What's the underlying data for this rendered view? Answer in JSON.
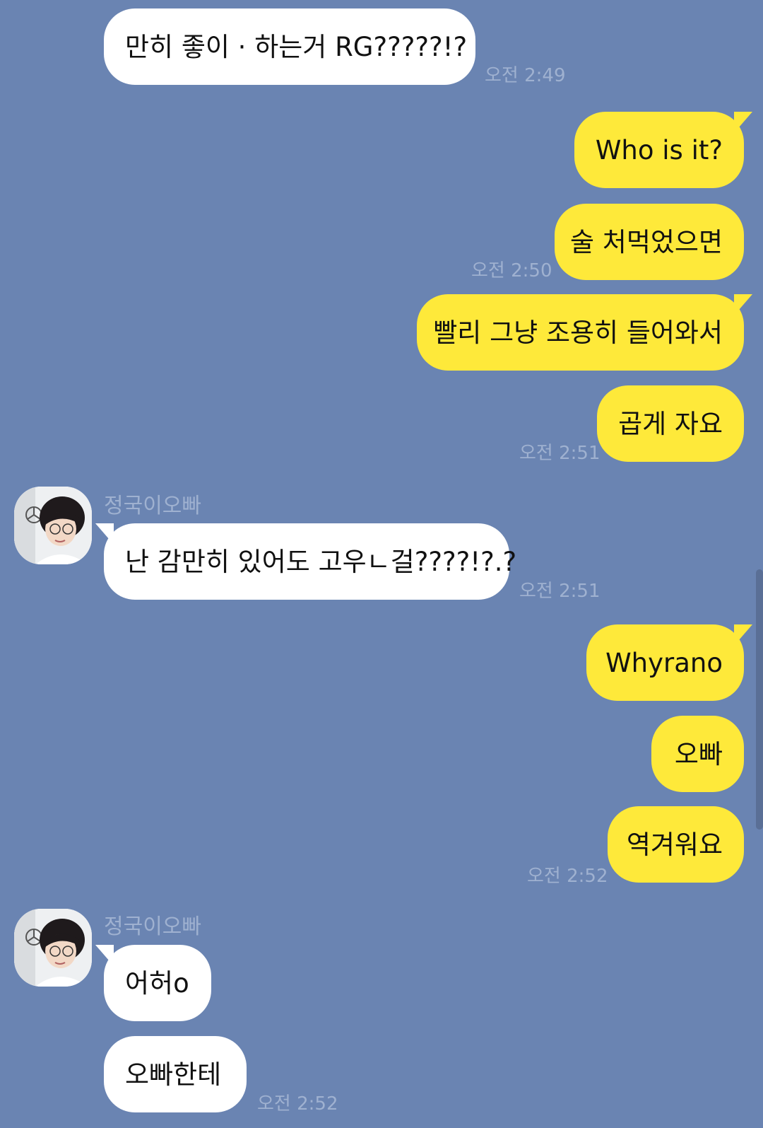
{
  "colors": {
    "background": "#6a84b2",
    "incoming_bubble": "#ffffff",
    "outgoing_bubble": "#fee93a",
    "meta_text": "#9fb1d0"
  },
  "messages": {
    "m1": "만히 좋이 · 하는거 RG?????!?",
    "m2": "Who is it?",
    "m3": "술 처먹었으면",
    "m4": "빨리 그냥 조용히 들어와서",
    "m5": "곱게 자요",
    "m6": "난 감만히 있어도 고우ㄴ걸????!?.?",
    "m7": "Whyrano",
    "m8": "오빠",
    "m9": "역겨워요",
    "m10": "어허o",
    "m11": "오빠한테"
  },
  "times": {
    "t1": "오전 2:49",
    "t2": "오전 2:50",
    "t3": "오전 2:51",
    "t4": "오전 2:51",
    "t5": "오전 2:52",
    "t6": "오전 2:52"
  },
  "sender": {
    "name": "정국이오빠",
    "avatar_icon": "profile-photo-icon"
  }
}
